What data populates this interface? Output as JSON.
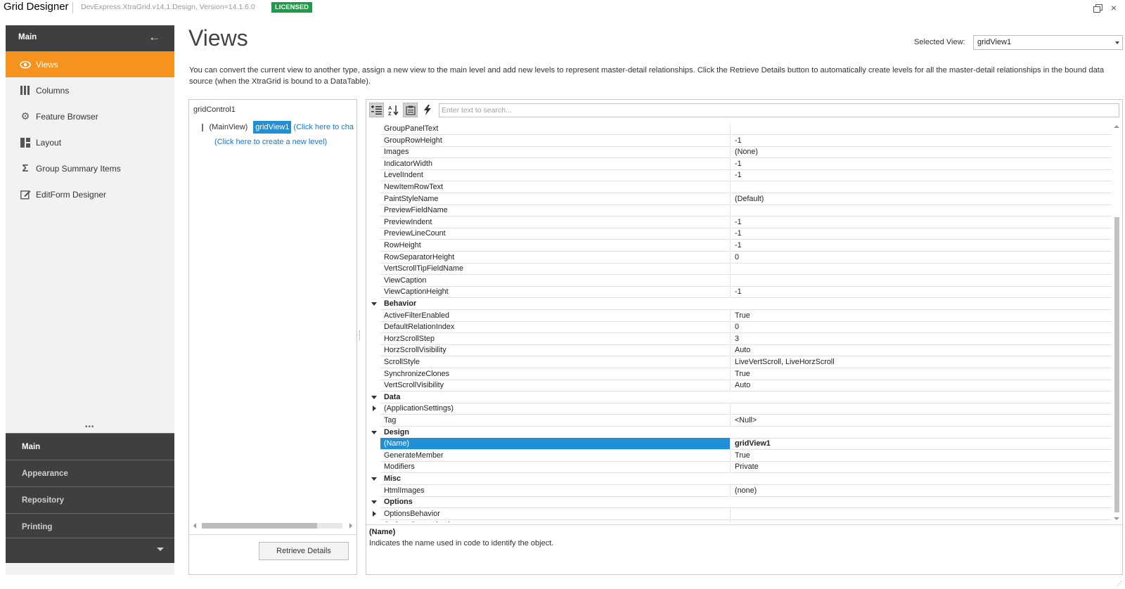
{
  "titlebar": {
    "title": "Grid Designer",
    "version": "DevExpress.XtraGrid.v14.1.Design, Version=14.1.6.0",
    "license_badge": "LICENSED",
    "close_glyph": "×"
  },
  "sidebar": {
    "header_label": "Main",
    "items": [
      {
        "label": "Views",
        "icon": "eye-icon"
      },
      {
        "label": "Columns",
        "icon": "columns-icon"
      },
      {
        "label": "Feature Browser",
        "icon": "gear-icon"
      },
      {
        "label": "Layout",
        "icon": "layout-icon"
      },
      {
        "label": "Group Summary Items",
        "icon": "sigma-icon"
      },
      {
        "label": "EditForm Designer",
        "icon": "edit-form-icon"
      }
    ],
    "groups": [
      "Main",
      "Appearance",
      "Repository",
      "Printing"
    ]
  },
  "page": {
    "title": "Views",
    "selected_view_label": "Selected View:",
    "selected_view_value": "gridView1",
    "description": "You can convert the current view to another type, assign a new view to the main level and add new levels to represent master-detail relationships. Click the Retrieve Details button to automatically create levels for all the master-detail relationships in the bound data source (when the XtraGrid is bound to a DataTable)."
  },
  "levels": {
    "root": "gridControl1",
    "main_view": "(MainView)",
    "view_name": "gridView1",
    "change_link": "(Click here to cha",
    "new_level_link": "(Click here to create a new level)",
    "retrieve_button": "Retrieve Details"
  },
  "property_grid": {
    "search_placeholder": "Enter text to search...",
    "rows": [
      {
        "type": "prop",
        "name": "GroupPanelText",
        "value": ""
      },
      {
        "type": "prop",
        "name": "GroupRowHeight",
        "value": "-1"
      },
      {
        "type": "prop",
        "name": "Images",
        "value": "(None)"
      },
      {
        "type": "prop",
        "name": "IndicatorWidth",
        "value": "-1"
      },
      {
        "type": "prop",
        "name": "LevelIndent",
        "value": "-1"
      },
      {
        "type": "prop",
        "name": "NewItemRowText",
        "value": ""
      },
      {
        "type": "prop",
        "name": "PaintStyleName",
        "value": "(Default)"
      },
      {
        "type": "prop",
        "name": "PreviewFieldName",
        "value": ""
      },
      {
        "type": "prop",
        "name": "PreviewIndent",
        "value": "-1"
      },
      {
        "type": "prop",
        "name": "PreviewLineCount",
        "value": "-1"
      },
      {
        "type": "prop",
        "name": "RowHeight",
        "value": "-1"
      },
      {
        "type": "prop",
        "name": "RowSeparatorHeight",
        "value": "0"
      },
      {
        "type": "prop",
        "name": "VertScrollTipFieldName",
        "value": ""
      },
      {
        "type": "prop",
        "name": "ViewCaption",
        "value": ""
      },
      {
        "type": "prop",
        "name": "ViewCaptionHeight",
        "value": "-1"
      },
      {
        "type": "cat",
        "name": "Behavior",
        "value": ""
      },
      {
        "type": "prop",
        "name": "ActiveFilterEnabled",
        "value": "True"
      },
      {
        "type": "prop",
        "name": "DefaultRelationIndex",
        "value": "0"
      },
      {
        "type": "prop",
        "name": "HorzScrollStep",
        "value": "3"
      },
      {
        "type": "prop",
        "name": "HorzScrollVisibility",
        "value": "Auto"
      },
      {
        "type": "prop",
        "name": "ScrollStyle",
        "value": "LiveVertScroll, LiveHorzScroll"
      },
      {
        "type": "prop",
        "name": "SynchronizeClones",
        "value": "True"
      },
      {
        "type": "prop",
        "name": "VertScrollVisibility",
        "value": "Auto"
      },
      {
        "type": "cat",
        "name": "Data",
        "value": ""
      },
      {
        "type": "sub",
        "name": "(ApplicationSettings)",
        "value": ""
      },
      {
        "type": "prop",
        "name": "Tag",
        "value": "<Null>"
      },
      {
        "type": "cat",
        "name": "Design",
        "value": ""
      },
      {
        "type": "sel",
        "name": "(Name)",
        "value": "gridView1"
      },
      {
        "type": "prop",
        "name": "GenerateMember",
        "value": "True"
      },
      {
        "type": "prop",
        "name": "Modifiers",
        "value": "Private"
      },
      {
        "type": "cat",
        "name": "Misc",
        "value": ""
      },
      {
        "type": "prop",
        "name": "HtmlImages",
        "value": "(none)"
      },
      {
        "type": "cat",
        "name": "Options",
        "value": ""
      },
      {
        "type": "sub",
        "name": "OptionsBehavior",
        "value": ""
      },
      {
        "type": "sub",
        "name": "OptionsCustomization",
        "value": ""
      }
    ],
    "desc_title": "(Name)",
    "desc_text": "Indicates the name used in code to identify the object."
  },
  "colors": {
    "accent": "#f6921e",
    "selection": "#1f8fd6",
    "dark_panel": "#3f3f3f",
    "license": "#1e9b47"
  }
}
